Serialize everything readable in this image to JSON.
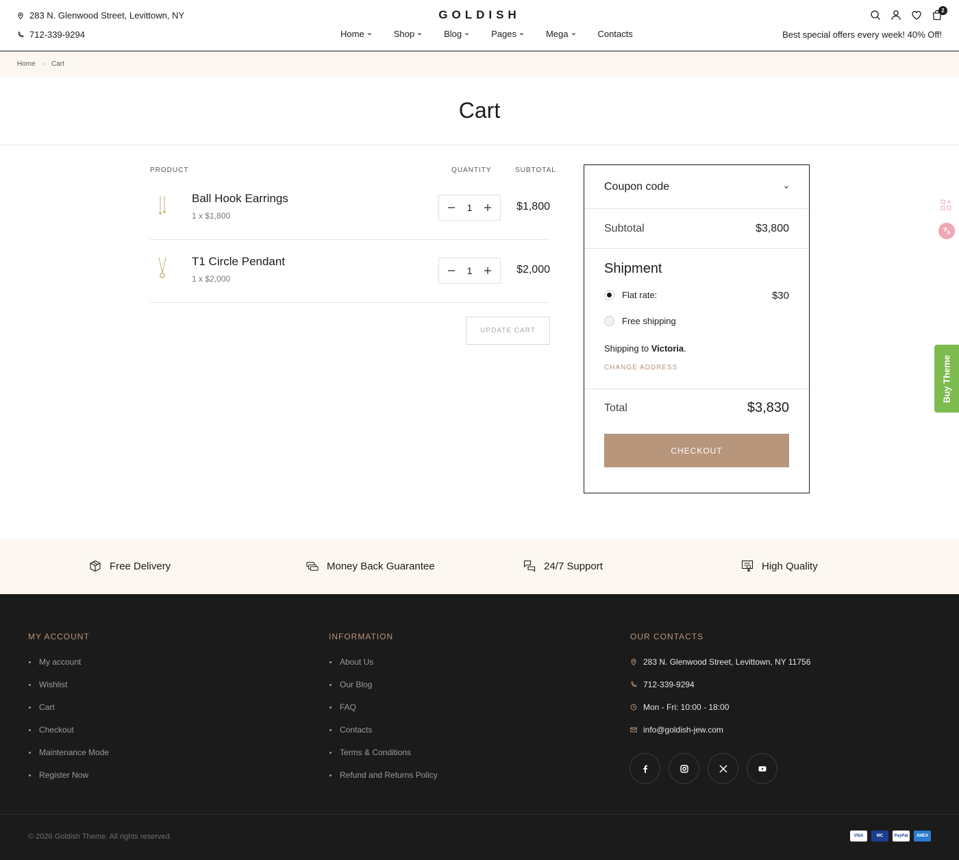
{
  "header": {
    "address": "283 N. Glenwood Street, Levittown, NY",
    "phone": "712-339-9294",
    "logo": "GOLDISH",
    "nav": [
      {
        "label": "Home",
        "dropdown": true
      },
      {
        "label": "Shop",
        "dropdown": true
      },
      {
        "label": "Blog",
        "dropdown": true
      },
      {
        "label": "Pages",
        "dropdown": true
      },
      {
        "label": "Mega",
        "dropdown": true
      },
      {
        "label": "Contacts",
        "dropdown": false
      }
    ],
    "cart_count": "2",
    "offer": "Best special offers every week! 40% Off!"
  },
  "breadcrumb": {
    "home": "Home",
    "current": "Cart"
  },
  "page": {
    "title": "Cart"
  },
  "cart": {
    "headers": {
      "product": "PRODUCT",
      "quantity": "QUANTITY",
      "subtotal": "SUBTOTAL"
    },
    "items": [
      {
        "name": "Ball Hook Earrings",
        "meta": "1 x $1,800",
        "qty": "1",
        "subtotal": "$1,800"
      },
      {
        "name": "T1 Circle Pendant",
        "meta": "1 x $2,000",
        "qty": "1",
        "subtotal": "$2,000"
      }
    ],
    "update_label": "UPDATE CART"
  },
  "summary": {
    "coupon_label": "Coupon code",
    "subtotal_label": "Subtotal",
    "subtotal_value": "$3,800",
    "shipment_title": "Shipment",
    "options": [
      {
        "label": "Flat rate:",
        "value": "$30",
        "selected": true
      },
      {
        "label": "Free shipping",
        "value": "",
        "selected": false
      }
    ],
    "shipping_to_prefix": "Shipping to",
    "shipping_to_place": "Victoria",
    "change_address": "CHANGE ADDRESS",
    "total_label": "Total",
    "total_value": "$3,830",
    "checkout_label": "CHECKOUT"
  },
  "side": {
    "buy_theme": "Buy Theme"
  },
  "features": [
    {
      "label": "Free Delivery",
      "icon": "box-icon"
    },
    {
      "label": "Money Back Guarantee",
      "icon": "money-icon"
    },
    {
      "label": "24/7 Support",
      "icon": "chat-icon"
    },
    {
      "label": "High Quality",
      "icon": "certificate-icon"
    }
  ],
  "footer": {
    "account_title": "MY ACCOUNT",
    "account_links": [
      "My account",
      "Wishlist",
      "Cart",
      "Checkout",
      "Maintenance Mode",
      "Register Now"
    ],
    "info_title": "INFORMATION",
    "info_links": [
      "About Us",
      "Our Blog",
      "FAQ",
      "Contacts",
      "Terms & Conditions",
      "Refund and Returns Policy"
    ],
    "contacts_title": "OUR CONTACTS",
    "address": "283 N. Glenwood Street, Levittown, NY 11756",
    "phone": "712-339-9294",
    "hours": "Mon - Fri: 10:00 - 18:00",
    "email": "info@goldish-jew.com",
    "socials": [
      "facebook-icon",
      "instagram-icon",
      "x-icon",
      "youtube-icon"
    ],
    "copyright": "© 2026 Goldish Theme. All rights reserved.",
    "payments": [
      {
        "label": "VISA",
        "bg": "#ffffff",
        "fg": "#1a3f8f"
      },
      {
        "label": "MC",
        "bg": "#1a3f8f",
        "fg": "#ffffff"
      },
      {
        "label": "PayPal",
        "bg": "#ffffff",
        "fg": "#1a3f8f"
      },
      {
        "label": "AMEX",
        "bg": "#2a7bd1",
        "fg": "#ffffff"
      }
    ]
  },
  "colors": {
    "accent": "#b8967c",
    "accent_text": "#b8927a",
    "footer_bg": "#1b1b1b",
    "strip_bg": "#fcf7f0",
    "buy_theme_bg": "#7dbb4f"
  }
}
